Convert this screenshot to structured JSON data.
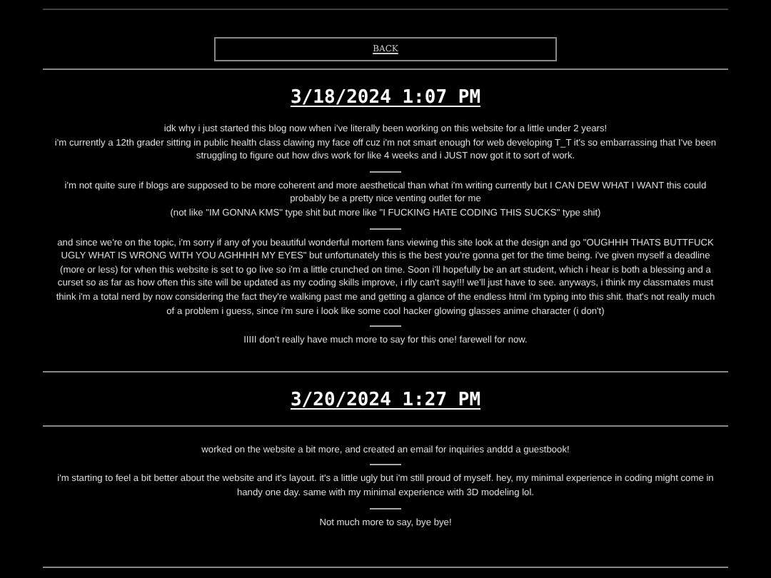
{
  "back_link": "BACK",
  "posts": [
    {
      "date": "3/18/2024 1:07 PM",
      "paragraphs": [
        [
          "idk why i just started this blog now when i've literally been working on this website for a little under 2 years!",
          "i'm currently a 12th grader sitting in public health class clawing my face off cuz i'm not smart enough for web developing T_T it's so embarrassing that I've been struggling to figure out how divs work for like 4 weeks and i JUST now got it to sort of work."
        ],
        [
          "i'm not quite sure if blogs are supposed to be more coherent and more aesthetical than what i'm writing currently but I CAN DEW WHAT I WANT this could probably be a pretty nice venting outlet for me",
          "(not like \"IM GONNA KMS\" type shit but more like \"I FUCKING HATE CODING THIS SUCKS\" type shit)"
        ],
        [
          "and since we're on the topic, i'm sorry if any of you beautiful wonderful mortem fans viewing this site look at the design and go \"OUGHHH THATS BUTTFUCK UGLY WHAT IS WRONG WITH YOU AGHHHH MY EYES\" but unfortunately this is the best you're gonna get for the time being. i've given myself a deadline (more or less) for when this website is set to go live so i'm a little crunched on time. Soon i'll hopefully be an art student, which i hear is both a blessing and a curset so as far as how often this site will be updated as my coding skills improve, i rlly can't say!!! we'll just have to see. anyways, i think my classmates must think i'm a total nerd by now considering the fact they're walking past me and getting a glance of the endless html i'm typing into this shit. that's not really much of a problem i guess, since i'm sure i look like some cool hacker glowing glasses anime character (i don't)"
        ],
        [
          "IIIII don't really have much more to say for this one! farewell for now."
        ]
      ]
    },
    {
      "date": "3/20/2024 1:27 PM",
      "paragraphs": [
        [
          "worked on the website a bit more, and created an email for inquiries anddd a guestbook!"
        ],
        [
          "i'm starting to feel a bit better about the website and it's layout. it's a little ugly but i'm still proud of myself. hey, my minimal experience in coding might come in handy one day. same with my minimal experience with 3D modeling lol."
        ],
        [
          "Not much more to say, bye bye!"
        ]
      ]
    }
  ]
}
